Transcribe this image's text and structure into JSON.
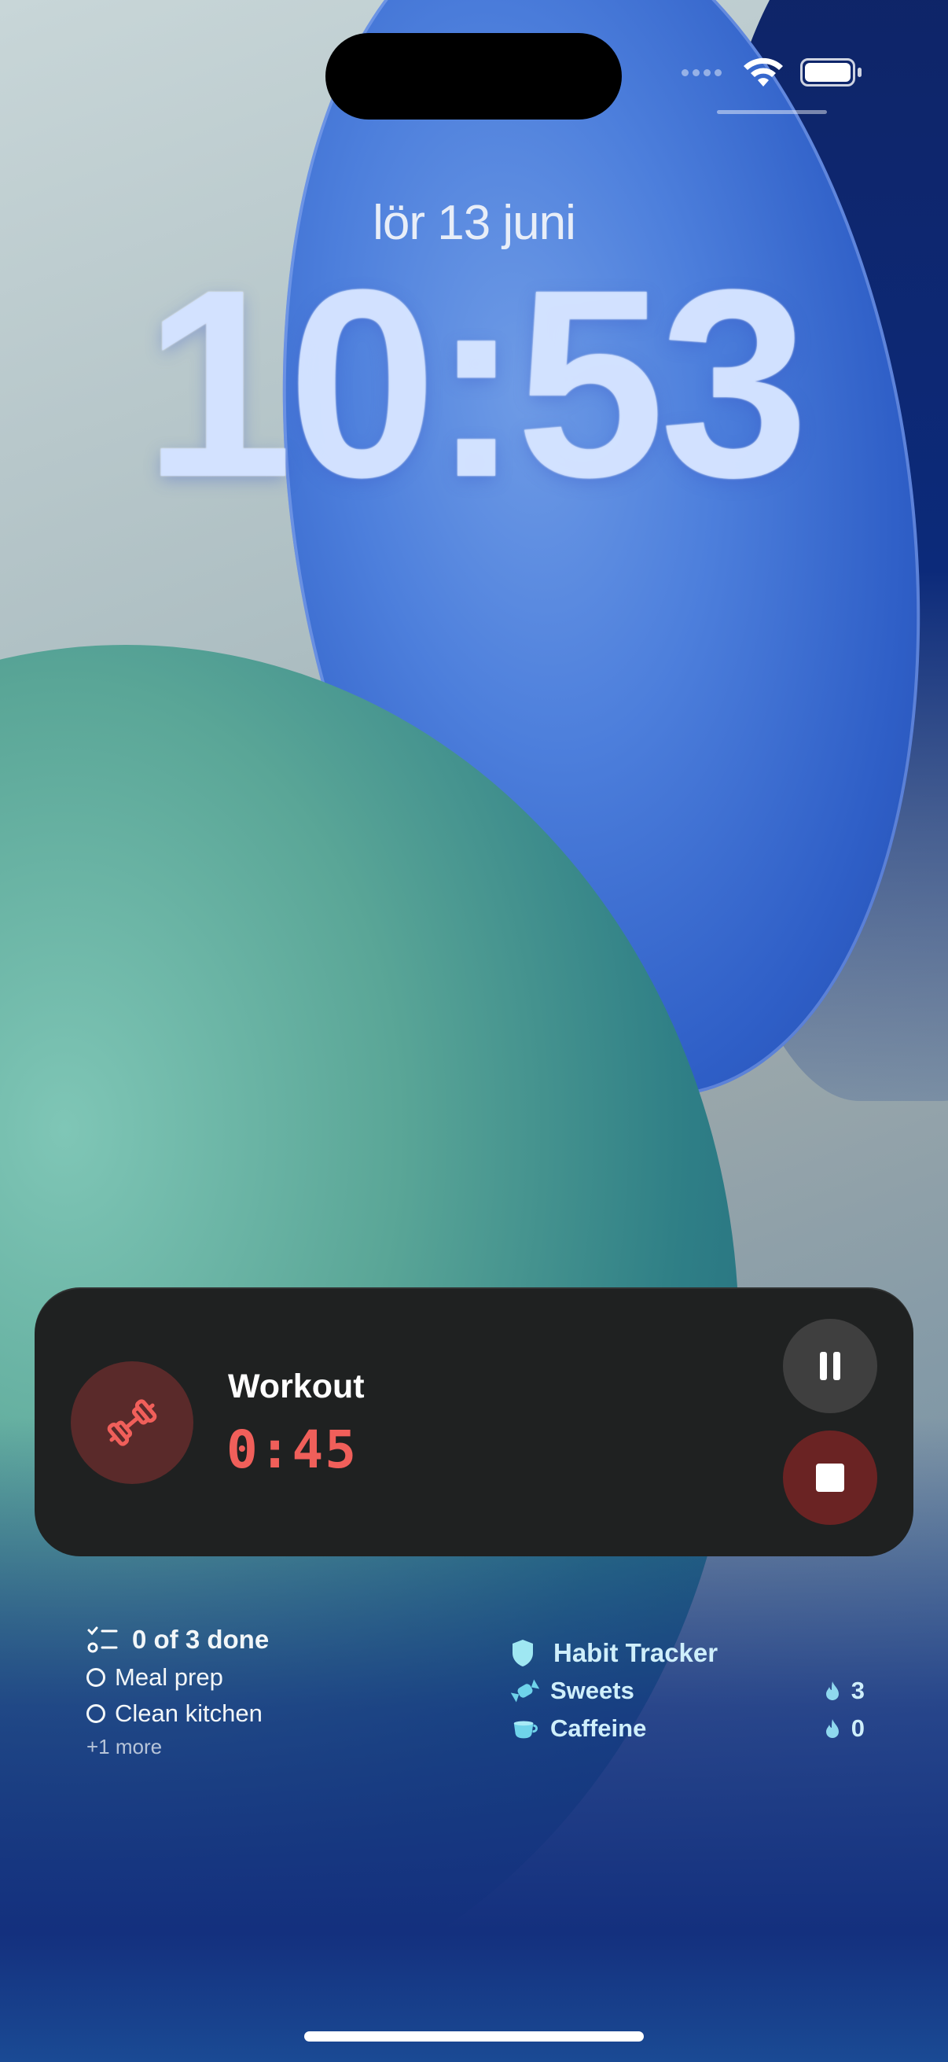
{
  "status_bar": {
    "wifi_icon": "wifi-icon",
    "battery_icon": "battery-icon",
    "cellular_icon": "cellular-dots-icon"
  },
  "lock_screen": {
    "date": "lör 13 juni",
    "time": "10:53"
  },
  "live_activity": {
    "icon": "dumbbell-icon",
    "title": "Workout",
    "timer": "0:45",
    "pause_icon": "pause-icon",
    "stop_icon": "stop-icon",
    "accent_color": "#f05f5a"
  },
  "todo_widget": {
    "summary": "0 of 3 done",
    "items": [
      {
        "label": "Meal prep",
        "done": false
      },
      {
        "label": "Clean kitchen",
        "done": false
      }
    ],
    "more": "+1 more"
  },
  "habit_widget": {
    "title": "Habit Tracker",
    "habits": [
      {
        "name": "Sweets",
        "icon": "candy-icon",
        "streak": "3"
      },
      {
        "name": "Caffeine",
        "icon": "cup-icon",
        "streak": "0"
      }
    ]
  }
}
